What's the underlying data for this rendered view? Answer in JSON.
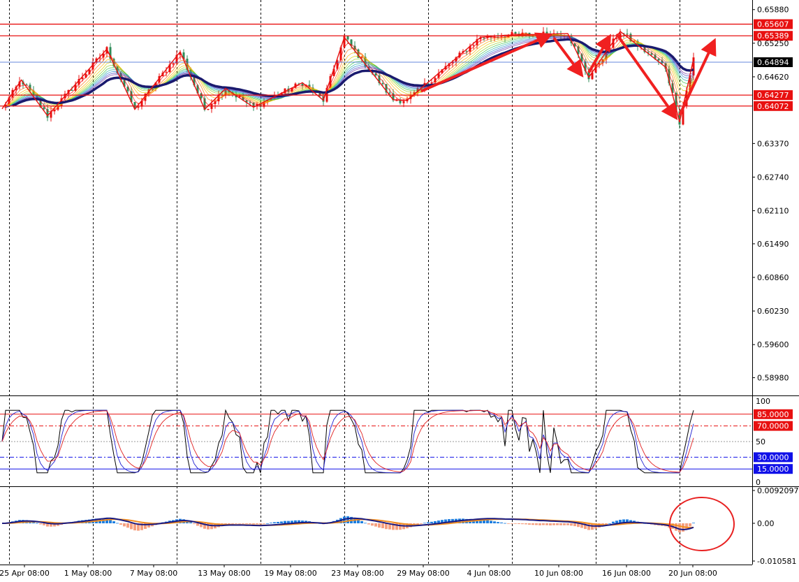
{
  "chart_data": [
    {
      "type": "candlestick",
      "pane": "price",
      "y_ticks": [
        "0.65880",
        "0.65250",
        "0.64620",
        "0.63370",
        "0.62740",
        "0.62110",
        "0.61490",
        "0.60860",
        "0.60230",
        "0.59600",
        "0.58980"
      ],
      "ylim": [
        0.5866,
        0.6606
      ],
      "price_labels": [
        {
          "value": 0.65607,
          "text": "0.65607",
          "color": "#e81010"
        },
        {
          "value": 0.65389,
          "text": "0.65389",
          "color": "#e81010"
        },
        {
          "value": 0.64894,
          "text": "0.64894",
          "color": "#000000"
        },
        {
          "value": 0.64277,
          "text": "0.64277",
          "color": "#e81010"
        },
        {
          "value": 0.64072,
          "text": "0.64072",
          "color": "#e81010"
        }
      ],
      "zigzag_points": [
        [
          0,
          0.6402
        ],
        [
          5.5,
          0.6456
        ],
        [
          13,
          0.6389
        ],
        [
          30,
          0.6514
        ],
        [
          38,
          0.6401
        ],
        [
          51,
          0.6509
        ],
        [
          58,
          0.6401
        ],
        [
          64,
          0.644
        ],
        [
          72,
          0.6405
        ],
        [
          86,
          0.6451
        ],
        [
          92,
          0.6418
        ],
        [
          98,
          0.6536
        ],
        [
          112,
          0.6419
        ],
        [
          116,
          0.6418
        ],
        [
          137,
          0.6536
        ],
        [
          144,
          0.654
        ],
        [
          162,
          0.6543
        ],
        [
          168,
          0.6461
        ],
        [
          177,
          0.6547
        ],
        [
          190,
          0.648
        ],
        [
          194,
          0.6377
        ],
        [
          198,
          0.6496
        ]
      ],
      "arrows": [
        {
          "from": [
            120,
            0.6435
          ],
          "to": [
            157,
            0.6541
          ]
        },
        {
          "from": [
            158,
            0.6535
          ],
          "to": [
            166,
            0.6465
          ]
        },
        {
          "from": [
            168,
            0.647
          ],
          "to": [
            174,
            0.6538
          ]
        },
        {
          "from": [
            176,
            0.6542
          ],
          "to": [
            193,
            0.6385
          ]
        },
        {
          "from": [
            194,
            0.639
          ],
          "to": [
            204,
            0.653
          ]
        }
      ]
    },
    {
      "type": "line",
      "pane": "stochastic",
      "y_ticks": [
        "100",
        "50",
        "0"
      ],
      "ylim": [
        0,
        100
      ],
      "levels": [
        {
          "value": 85,
          "text": "85.0000",
          "color": "#e81010"
        },
        {
          "value": 70,
          "text": "70.0000",
          "color": "#e81010"
        },
        {
          "value": 30,
          "text": "30.0000",
          "color": "#1010e8"
        },
        {
          "value": 15,
          "text": "15.0000",
          "color": "#1010e8"
        }
      ]
    },
    {
      "type": "histogram",
      "pane": "macd",
      "y_ticks": [
        "0.0092097",
        "0.00",
        "-0.010581"
      ],
      "ylim": [
        -0.010581,
        0.0092097
      ]
    }
  ],
  "x_ticks": [
    "25 Apr 08:00",
    "1 May 08:00",
    "7 May 08:00",
    "13 May 08:00",
    "19 May 08:00",
    "23 May 08:00",
    "29 May 08:00",
    "4 Jun 08:00",
    "10 Jun 08:00",
    "16 Jun 08:00",
    "20 Jun 08:00"
  ],
  "colors": {
    "bull": "#e81010",
    "bear": "#2e8b57",
    "ma_slow": "#1a1a6e",
    "level_red": "#e81010",
    "level_blue": "#1010e8",
    "hist_pos": "#1e7fe0",
    "hist_neg": "#f5a080",
    "signal": "#f08c20",
    "macd": "#1a1a80"
  }
}
